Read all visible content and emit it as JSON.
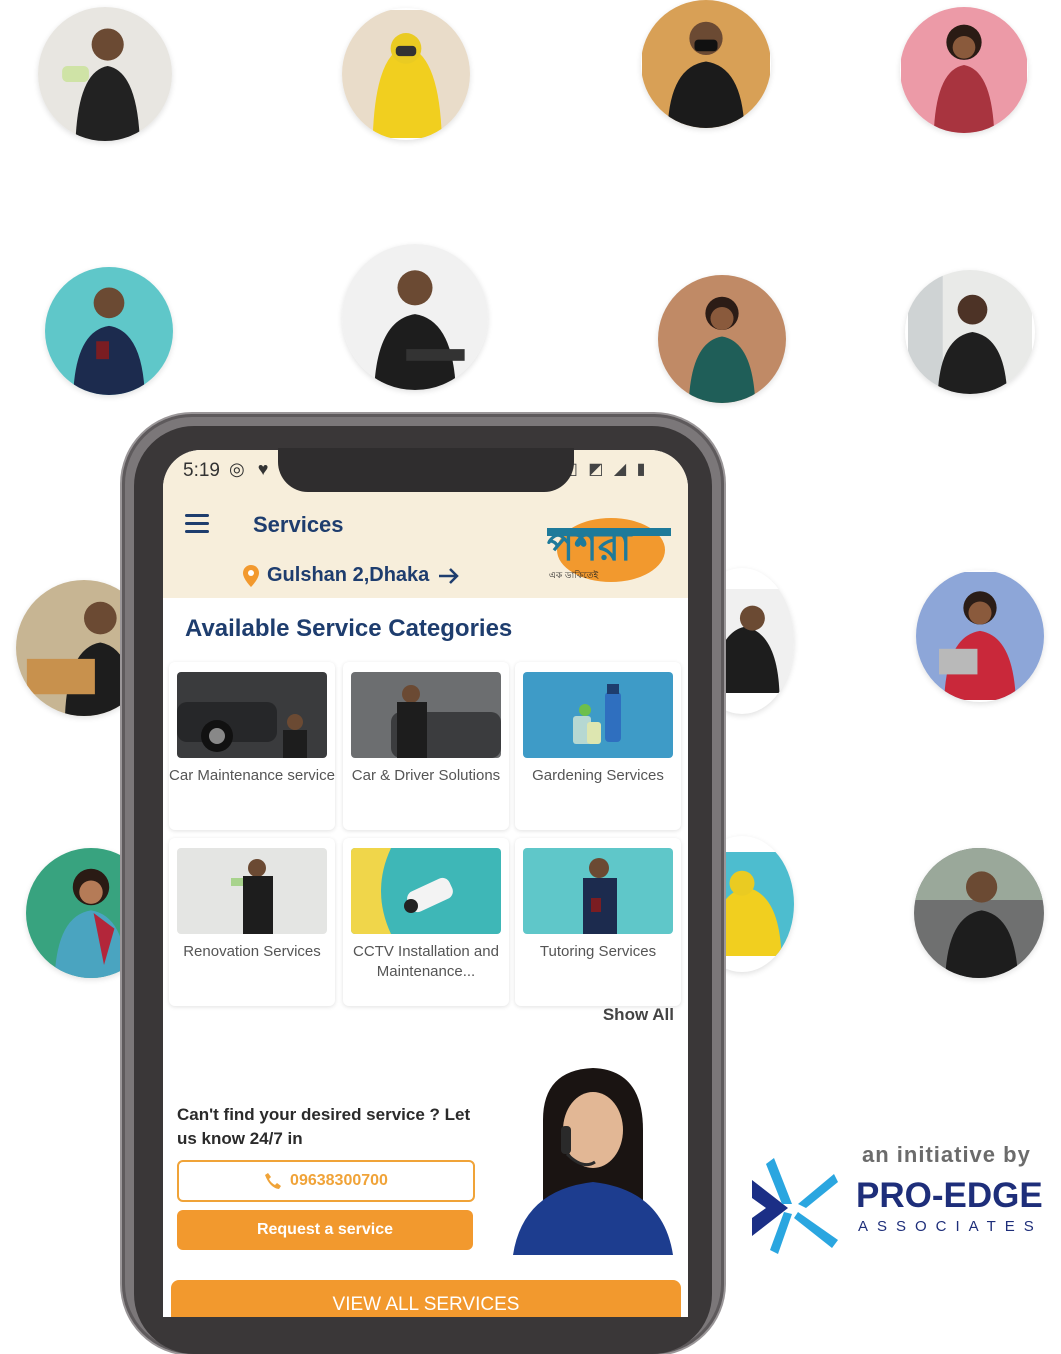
{
  "status_bar": {
    "time": "5:19"
  },
  "header": {
    "title": "Services",
    "location": "Gulshan 2,Dhaka",
    "logo_bengali": "পশরা",
    "logo_tagline": "এক ডাকিতেই"
  },
  "categories_section": {
    "title": "Available Service Categories",
    "items": [
      {
        "label": "Car Maintenance service"
      },
      {
        "label": "Car & Driver Solutions"
      },
      {
        "label": "Gardening Services"
      },
      {
        "label": "Renovation Services"
      },
      {
        "label": "CCTV Installation and Maintenance..."
      },
      {
        "label": "Tutoring Services"
      }
    ],
    "show_all": "Show All"
  },
  "cta": {
    "text": "Can't find your desired service ? Let us know 24/7 in",
    "phone": "09638300700",
    "request_button": "Request a service"
  },
  "view_all_button": "VIEW ALL SERVICES",
  "branding": {
    "initiative_text": "an initiative by",
    "company_name": "PRO-EDGE",
    "company_sub": "ASSOCIATES"
  },
  "colors": {
    "navy": "#1e3d6e",
    "orange": "#f2992e",
    "cream": "#f7eedb",
    "pro_edge_blue": "#1e2e7a"
  }
}
